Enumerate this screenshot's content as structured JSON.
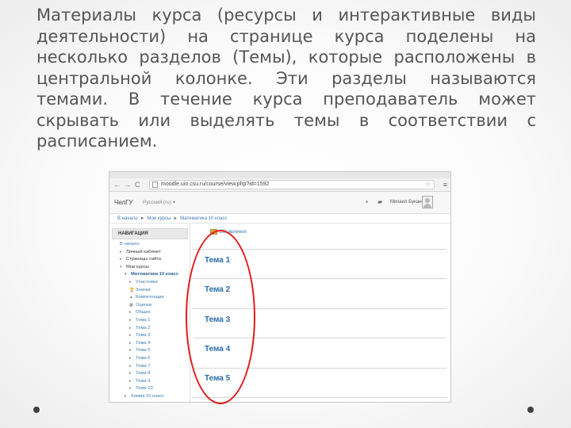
{
  "slide": {
    "text": "Материалы курса (ресурсы и интерактивные виды деятельности) на странице курса поделены на несколько разделов (Темы), которые расположены в центральной колонке. Эти разделы называются темами. В течение курса преподаватель может скрывать или выделять темы в соответствии с расписанием."
  },
  "browser": {
    "url": "moodle.uio.csu.ru/course/view.php?id=1592",
    "icons": {
      "back": "arrow-left-icon",
      "forward": "arrow-right-icon",
      "reload": "reload-icon",
      "bookmark": "star-icon",
      "menu": "menu-icon"
    }
  },
  "site": {
    "brand": "ЧелГУ",
    "language": "Русский (ru) ▾",
    "user_name": "Михаил Буканов"
  },
  "breadcrumb": [
    "В начало",
    "Мои курсы",
    "Математика 10 класс"
  ],
  "navigation": {
    "heading": "НАВИГАЦИЯ",
    "items": [
      {
        "label": "В начало",
        "mark": ""
      },
      {
        "label": "Личный кабинет",
        "mark": "▸"
      },
      {
        "label": "Страницы сайта",
        "mark": "▸"
      },
      {
        "label": "Мои курсы",
        "mark": "▾"
      },
      {
        "label": "Математика 10 класс",
        "mark": "▾"
      },
      {
        "label": "Участники",
        "mark": "▸"
      },
      {
        "label": "Значки",
        "mark": "🏆"
      },
      {
        "label": "Компетенции",
        "mark": "▲"
      },
      {
        "label": "Оценки",
        "mark": "▦"
      },
      {
        "label": "Общее",
        "mark": "▸"
      },
      {
        "label": "Тема 1",
        "mark": "▸"
      },
      {
        "label": "Тема 2",
        "mark": "▸"
      },
      {
        "label": "Тема 3",
        "mark": "▸"
      },
      {
        "label": "Тема 4",
        "mark": "▸"
      },
      {
        "label": "Тема 5",
        "mark": "▸"
      },
      {
        "label": "Тема 6",
        "mark": "▸"
      },
      {
        "label": "Тема 7",
        "mark": "▸"
      },
      {
        "label": "Тема 8",
        "mark": "▸"
      },
      {
        "label": "Тема 9",
        "mark": "▸"
      },
      {
        "label": "Тема 10",
        "mark": "▸"
      },
      {
        "label": "Химия 10 класс",
        "mark": "▸"
      }
    ]
  },
  "content": {
    "announcements": "Объявления",
    "topics": [
      "Тема 1",
      "Тема 2",
      "Тема 3",
      "Тема 4",
      "Тема 5"
    ]
  },
  "colors": {
    "highlight_ellipse": "#e01b1b",
    "link": "#3a7bb5",
    "topic": "#2a6ea8"
  }
}
